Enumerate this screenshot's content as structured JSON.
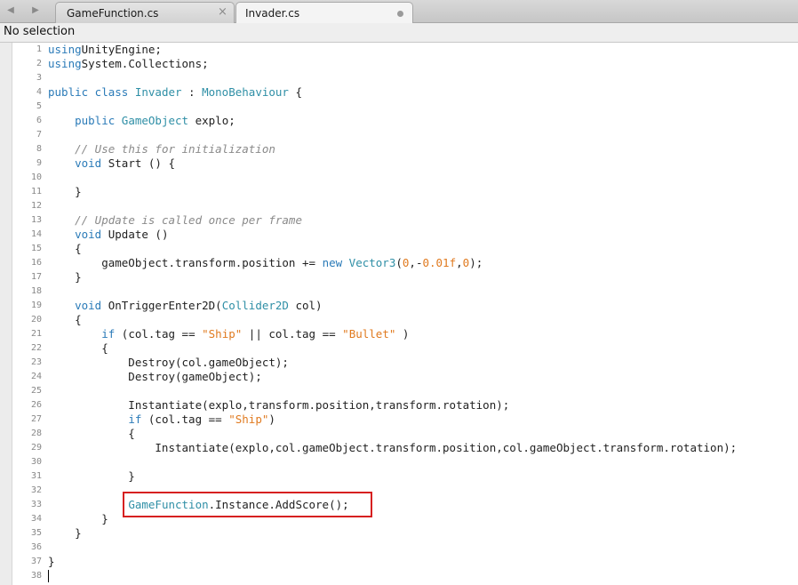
{
  "tabs": [
    {
      "label": "GameFunction.cs",
      "active": false,
      "close_glyph": "×"
    },
    {
      "label": "Invader.cs",
      "active": true
    }
  ],
  "nav": {
    "back_glyph": "◀",
    "forward_glyph": "▶"
  },
  "status": {
    "selection": "No selection"
  },
  "colors": {
    "keyword": "#2b7bb8",
    "type": "#2f8fa6",
    "comment": "#8a8a8a",
    "string": "#e07a1f",
    "highlight": "#d62020"
  },
  "code_lines": [
    {
      "n": "1",
      "segs": [
        [
          "kw",
          "using"
        ],
        [
          "",
          "UnityEngine;"
        ]
      ]
    },
    {
      "n": "2",
      "segs": [
        [
          "kw",
          "using"
        ],
        [
          "",
          "System.Collections;"
        ]
      ]
    },
    {
      "n": "3",
      "segs": []
    },
    {
      "n": "4",
      "segs": [
        [
          "kw",
          "public class"
        ],
        [
          "",
          ""
        ],
        [
          "ty",
          "Invader"
        ],
        [
          "",
          " : "
        ],
        [
          "ty",
          "MonoBehaviour"
        ],
        [
          "",
          " {"
        ]
      ]
    },
    {
      "n": "5",
      "segs": []
    },
    {
      "n": "6",
      "segs": [
        [
          "",
          "    "
        ],
        [
          "kw",
          "public"
        ],
        [
          "",
          ""
        ],
        [
          "ty",
          "GameObject"
        ],
        [
          "",
          " explo;"
        ]
      ]
    },
    {
      "n": "7",
      "segs": []
    },
    {
      "n": "8",
      "segs": [
        [
          "",
          "    "
        ],
        [
          "cm",
          "// Use this for initialization"
        ]
      ]
    },
    {
      "n": "9",
      "segs": [
        [
          "",
          "    "
        ],
        [
          "kw",
          "void"
        ],
        [
          "",
          " Start () {"
        ]
      ]
    },
    {
      "n": "10",
      "segs": []
    },
    {
      "n": "11",
      "segs": [
        [
          "",
          "    }"
        ]
      ]
    },
    {
      "n": "12",
      "segs": []
    },
    {
      "n": "13",
      "segs": [
        [
          "",
          "    "
        ],
        [
          "cm",
          "// Update is called once per frame"
        ]
      ]
    },
    {
      "n": "14",
      "segs": [
        [
          "",
          "    "
        ],
        [
          "kw",
          "void"
        ],
        [
          "",
          " Update ()"
        ]
      ]
    },
    {
      "n": "15",
      "segs": [
        [
          "",
          "    {"
        ]
      ]
    },
    {
      "n": "16",
      "segs": [
        [
          "",
          "        gameObject.transform.position += "
        ],
        [
          "kw",
          "new"
        ],
        [
          "",
          ""
        ],
        [
          "ty",
          "Vector3"
        ],
        [
          "",
          "("
        ],
        [
          "nu",
          "0"
        ],
        [
          "",
          ",-"
        ],
        [
          "nu",
          "0.01f"
        ],
        [
          "",
          ","
        ],
        [
          "nu",
          "0"
        ],
        [
          "",
          ");"
        ]
      ]
    },
    {
      "n": "17",
      "segs": [
        [
          "",
          "    }"
        ]
      ]
    },
    {
      "n": "18",
      "segs": []
    },
    {
      "n": "19",
      "segs": [
        [
          "",
          "    "
        ],
        [
          "kw",
          "void"
        ],
        [
          "",
          " OnTriggerEnter2D("
        ],
        [
          "ty",
          "Collider2D"
        ],
        [
          "",
          " col)"
        ]
      ]
    },
    {
      "n": "20",
      "segs": [
        [
          "",
          "    {"
        ]
      ]
    },
    {
      "n": "21",
      "segs": [
        [
          "",
          "        "
        ],
        [
          "kw",
          "if"
        ],
        [
          "",
          " (col.tag == "
        ],
        [
          "st",
          "\"Ship\""
        ],
        [
          "",
          " || col.tag == "
        ],
        [
          "st",
          "\"Bullet\""
        ],
        [
          "",
          " )"
        ]
      ]
    },
    {
      "n": "22",
      "segs": [
        [
          "",
          "        {"
        ]
      ]
    },
    {
      "n": "23",
      "segs": [
        [
          "",
          "            Destroy(col.gameObject);"
        ]
      ]
    },
    {
      "n": "24",
      "segs": [
        [
          "",
          "            Destroy(gameObject);"
        ]
      ]
    },
    {
      "n": "25",
      "segs": []
    },
    {
      "n": "26",
      "segs": [
        [
          "",
          "            Instantiate(explo,transform.position,transform.rotation);"
        ]
      ]
    },
    {
      "n": "27",
      "segs": [
        [
          "",
          "            "
        ],
        [
          "kw",
          "if"
        ],
        [
          "",
          " (col.tag == "
        ],
        [
          "st",
          "\"Ship\""
        ],
        [
          "",
          ")"
        ]
      ]
    },
    {
      "n": "28",
      "segs": [
        [
          "",
          "            {"
        ]
      ]
    },
    {
      "n": "29",
      "segs": [
        [
          "",
          "                Instantiate(explo,col.gameObject.transform.position,col.gameObject.transform.rotation);"
        ]
      ]
    },
    {
      "n": "30",
      "segs": []
    },
    {
      "n": "31",
      "segs": [
        [
          "",
          "            }"
        ]
      ]
    },
    {
      "n": "32",
      "segs": []
    },
    {
      "n": "33",
      "segs": [
        [
          "",
          "            "
        ],
        [
          "ty",
          "GameFunction"
        ],
        [
          "",
          ".Instance.AddScore();"
        ]
      ]
    },
    {
      "n": "34",
      "segs": [
        [
          "",
          "        }"
        ]
      ]
    },
    {
      "n": "35",
      "segs": [
        [
          "",
          "    }"
        ]
      ]
    },
    {
      "n": "36",
      "segs": []
    },
    {
      "n": "37",
      "segs": [
        [
          "",
          "}"
        ]
      ]
    },
    {
      "n": "38",
      "segs": []
    }
  ]
}
